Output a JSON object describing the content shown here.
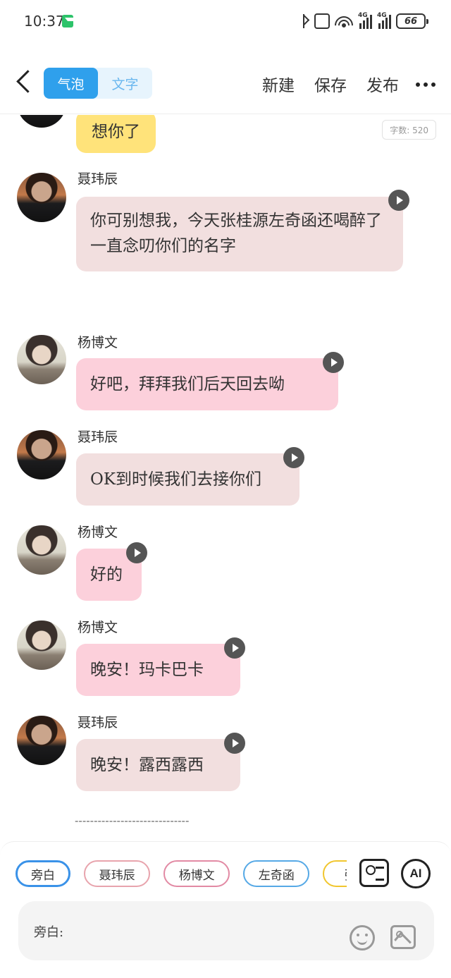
{
  "status_bar": {
    "time": "10:37",
    "battery": "66",
    "signal1_label": "4G",
    "signal2_label": "4G"
  },
  "toolbar": {
    "tabs": [
      "气泡",
      "文字"
    ],
    "active_tab": "气泡",
    "new_label": "新建",
    "save_label": "保存",
    "publish_label": "发布"
  },
  "chat": {
    "word_count": "字数: 520",
    "messages": [
      {
        "speaker": "",
        "text": "想你了",
        "color": "#ffe37a"
      },
      {
        "speaker": "聂玮辰",
        "text": "你可别想我，今天张桂源左奇函还喝醉了一直念叨你们的名字",
        "color": "#f2dfdf"
      },
      {
        "speaker": "杨博文",
        "text": "好吧，拜拜我们后天回去呦",
        "color": "#fcd0db"
      },
      {
        "speaker": "聂玮辰",
        "text": "OK到时候我们去接你们",
        "color": "#f2dfdf"
      },
      {
        "speaker": "杨博文",
        "text": "好的",
        "color": "#fcd0db"
      },
      {
        "speaker": "杨博文",
        "text": "晚安！玛卡巴卡",
        "color": "#fcd0db"
      },
      {
        "speaker": "聂玮辰",
        "text": "晚安！露西露西",
        "color": "#f2dfdf"
      }
    ],
    "divider": "------------------------------"
  },
  "bottom": {
    "chips": [
      {
        "label": "旁白",
        "color": "#3a92e8"
      },
      {
        "label": "聂玮辰",
        "color": "#e8a4ad"
      },
      {
        "label": "杨博文",
        "color": "#e28aa4"
      },
      {
        "label": "左奇函",
        "color": "#56a9e6"
      },
      {
        "label": "张函",
        "color": "#f1c62e"
      }
    ],
    "ai_label": "AI",
    "input_label": "旁白:"
  }
}
